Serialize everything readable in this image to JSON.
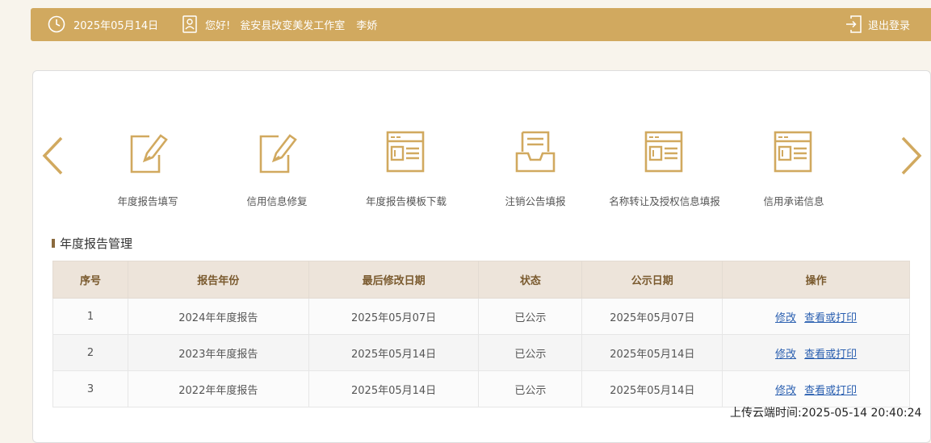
{
  "topbar": {
    "date": "2025年05月14日",
    "greeting": "您好!",
    "company": "瓮安县改变美发工作室",
    "user": "李娇",
    "logout": "退出登录"
  },
  "functions": [
    {
      "label": "年度报告填写",
      "icon": "edit-icon"
    },
    {
      "label": "信用信息修复",
      "icon": "edit-icon"
    },
    {
      "label": "年度报告模板下载",
      "icon": "document-icon"
    },
    {
      "label": "注销公告填报",
      "icon": "inbox-icon"
    },
    {
      "label": "名称转让及授权信息填报",
      "icon": "document-icon"
    },
    {
      "label": "信用承诺信息",
      "icon": "document-icon"
    }
  ],
  "section": {
    "title": "年度报告管理"
  },
  "table": {
    "headers": [
      "序号",
      "报告年份",
      "最后修改日期",
      "状态",
      "公示日期",
      "操作"
    ],
    "rows": [
      {
        "no": "1",
        "year": "2024年年度报告",
        "modified": "2025年05月07日",
        "status": "已公示",
        "published": "2025年05月07日",
        "edit": "修改",
        "view": "查看或打印"
      },
      {
        "no": "2",
        "year": "2023年年度报告",
        "modified": "2025年05月14日",
        "status": "已公示",
        "published": "2025年05月14日",
        "edit": "修改",
        "view": "查看或打印"
      },
      {
        "no": "3",
        "year": "2022年年度报告",
        "modified": "2025年05月14日",
        "status": "已公示",
        "published": "2025年05月14日",
        "edit": "修改",
        "view": "查看或打印"
      }
    ]
  },
  "footer": {
    "upload_time": "上传云端时间:2025-05-14 20:40:24"
  },
  "colors": {
    "accent": "#d1a95f",
    "header_bg": "#ede4da",
    "link": "#2a5fb0"
  }
}
